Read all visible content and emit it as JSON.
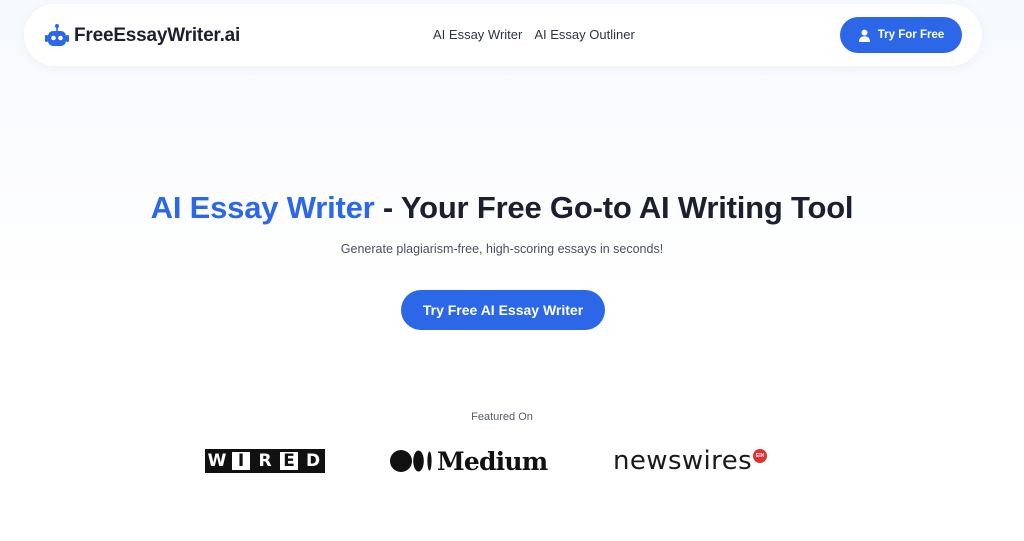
{
  "header": {
    "brand": "FreeEssayWriter.ai",
    "logo_icon": "robot-icon",
    "nav": [
      "AI Essay Writer",
      "AI Essay Outliner"
    ],
    "cta_label": "Try For Free",
    "cta_icon": "user-icon"
  },
  "hero": {
    "title_accent": "AI Essay Writer",
    "title_rest": " - Your Free Go-to AI Writing Tool",
    "subtitle": "Generate plagiarism-free, high-scoring essays in seconds!",
    "cta_label": "Try Free AI Essay Writer"
  },
  "featured": {
    "label": "Featured On",
    "wired_letters": [
      "W",
      "I",
      "R",
      "E",
      "D"
    ],
    "medium": "Medium",
    "newswires": "newswires",
    "ein_badge": "EIN"
  },
  "colors": {
    "accent": "#2c67e7",
    "text_dark": "#1c1f2e",
    "ein_red": "#e0302f"
  }
}
